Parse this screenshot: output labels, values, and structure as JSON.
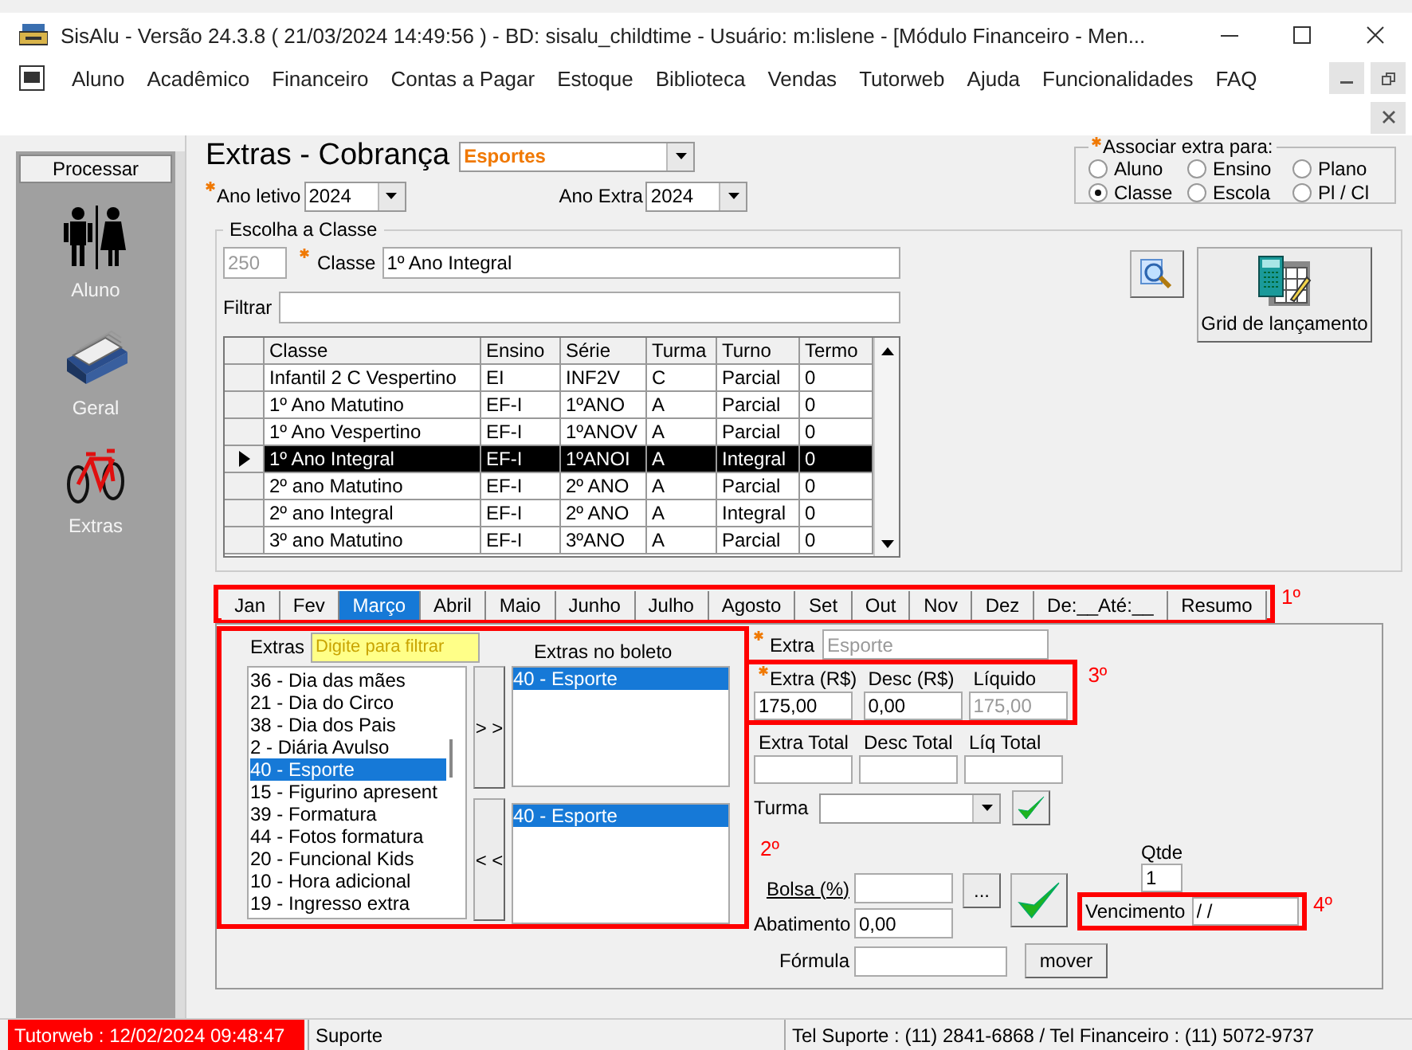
{
  "window": {
    "title": "SisAlu - Versão 24.3.8 ( 21/03/2024 14:49:56 ) - BD: sisalu_childtime - Usuário: m:lislene - [Módulo Financeiro - Men..."
  },
  "menu": [
    "Aluno",
    "Acadêmico",
    "Financeiro",
    "Contas a Pagar",
    "Estoque",
    "Biblioteca",
    "Vendas",
    "Tutorweb",
    "Ajuda",
    "Funcionalidades",
    "FAQ"
  ],
  "sidebar": {
    "header": "Processar",
    "items": [
      {
        "kind": "people",
        "label": "Aluno"
      },
      {
        "kind": "cards",
        "label": "Geral"
      },
      {
        "kind": "bike",
        "label": "Extras"
      }
    ]
  },
  "form": {
    "title": "Extras - Cobrança",
    "category": "Esportes",
    "ano_letivo": {
      "label": "Ano letivo",
      "value": "2024",
      "required": true
    },
    "ano_extra": {
      "label": "Ano Extra",
      "value": "2024",
      "required": false
    }
  },
  "associar": {
    "label": "Associar extra para:",
    "required": true,
    "options": [
      {
        "label": "Aluno",
        "selected": false
      },
      {
        "label": "Ensino",
        "selected": false
      },
      {
        "label": "Plano",
        "selected": false
      },
      {
        "label": "Classe",
        "selected": true
      },
      {
        "label": "Escola",
        "selected": false
      },
      {
        "label": "Pl / Cl",
        "selected": false
      }
    ]
  },
  "classe": {
    "title": "Escolha a Classe",
    "code": "250",
    "label": "Classe",
    "required": true,
    "value": "1º Ano Integral",
    "filter_label": "Filtrar",
    "grid_button": "Grid de lançamento"
  },
  "table": {
    "columns": [
      "Classe",
      "Ensino",
      "Série",
      "Turma",
      "Turno",
      "Termo"
    ],
    "rows": [
      {
        "cells": [
          "Infantil 2 C Vespertino",
          "EI",
          "INF2V",
          "C",
          "Parcial",
          "0"
        ],
        "selected": false
      },
      {
        "cells": [
          "1º Ano Matutino",
          "EF-I",
          "1ºANO",
          "A",
          "Parcial",
          "0"
        ],
        "selected": false
      },
      {
        "cells": [
          "1º Ano Vespertino",
          "EF-I",
          "1ºANOV",
          "A",
          "Parcial",
          "0"
        ],
        "selected": false
      },
      {
        "cells": [
          "1º Ano Integral",
          "EF-I",
          "1ºANOI",
          "A",
          "Integral",
          "0"
        ],
        "selected": true
      },
      {
        "cells": [
          "2º ano Matutino",
          "EF-I",
          "2º ANO",
          "A",
          "Parcial",
          "0"
        ],
        "selected": false
      },
      {
        "cells": [
          "2º ano Integral",
          "EF-I",
          "2º ANO",
          "A",
          "Integral",
          "0"
        ],
        "selected": false
      },
      {
        "cells": [
          "3º ano Matutino",
          "EF-I",
          "3ºANO",
          "A",
          "Parcial",
          "0"
        ],
        "selected": false
      }
    ]
  },
  "months": {
    "annotation": "1º",
    "tabs": [
      {
        "label": "Jan",
        "selected": false
      },
      {
        "label": "Fev",
        "selected": false
      },
      {
        "label": "Março",
        "selected": true
      },
      {
        "label": "Abril",
        "selected": false
      },
      {
        "label": "Maio",
        "selected": false
      },
      {
        "label": "Junho",
        "selected": false
      },
      {
        "label": "Julho",
        "selected": false
      },
      {
        "label": "Agosto",
        "selected": false
      },
      {
        "label": "Set",
        "selected": false
      },
      {
        "label": "Out",
        "selected": false
      },
      {
        "label": "Nov",
        "selected": false
      },
      {
        "label": "Dez",
        "selected": false
      },
      {
        "label": "De:__Até:__",
        "selected": false
      },
      {
        "label": "Resumo",
        "selected": false
      }
    ]
  },
  "extras": {
    "annotation": "2º",
    "label": "Extras",
    "filter_placeholder": "Digite para filtrar",
    "items": [
      {
        "label": "36 - Dia das mães",
        "selected": false
      },
      {
        "label": "21 - Dia do Circo",
        "selected": false
      },
      {
        "label": "38 - Dia dos Pais",
        "selected": false
      },
      {
        "label": "2 - Diária Avulso",
        "selected": false
      },
      {
        "label": "40 - Esporte",
        "selected": true
      },
      {
        "label": "15 - Figurino apresent",
        "selected": false
      },
      {
        "label": "39 - Formatura",
        "selected": false
      },
      {
        "label": "44 - Fotos formatura",
        "selected": false
      },
      {
        "label": "20 - Funcional Kids",
        "selected": false
      },
      {
        "label": "10 - Hora adicional",
        "selected": false
      },
      {
        "label": "19 - Ingresso extra",
        "selected": false
      }
    ],
    "add_button": "> >",
    "remove_button": "< <",
    "boleto_label": "Extras no boleto",
    "boleto_top": [
      {
        "label": "40 - Esporte",
        "selected": true
      }
    ],
    "boleto_bottom": [
      {
        "label": "40 - Esporte",
        "selected": true
      }
    ]
  },
  "details": {
    "extra": {
      "label": "Extra",
      "value": "Esporte",
      "required": true,
      "disabled": true
    },
    "amounts_annotation": "3º",
    "amounts": [
      {
        "label": "Extra (R$)",
        "value": "175,00",
        "required": true,
        "disabled": false
      },
      {
        "label": "Desc (R$)",
        "value": "0,00",
        "required": false,
        "disabled": false
      },
      {
        "label": "Líquido",
        "value": "175,00",
        "required": false,
        "disabled": true
      }
    ],
    "totals": [
      {
        "label": "Extra Total"
      },
      {
        "label": "Desc Total"
      },
      {
        "label": "Líq Total"
      }
    ],
    "turma_label": "Turma",
    "bolsa_label": "Bolsa (%)",
    "bolsa_button": "...",
    "abatimento_label": "Abatimento",
    "abatimento": "0,00",
    "formula_label": "Fórmula",
    "qtde_label": "Qtde",
    "qtde": "1",
    "vencimento_label": "Vencimento",
    "vencimento": "/ /",
    "vencimento_annotation": "4º",
    "mover_button": "mover"
  },
  "status_bar": {
    "tutorweb": "Tutorweb : 12/02/2024 09:48:47",
    "suporte": "Suporte",
    "phones": "Tel Suporte : (11) 2841-6868 / Tel Financeiro : (11) 5072-9737"
  }
}
